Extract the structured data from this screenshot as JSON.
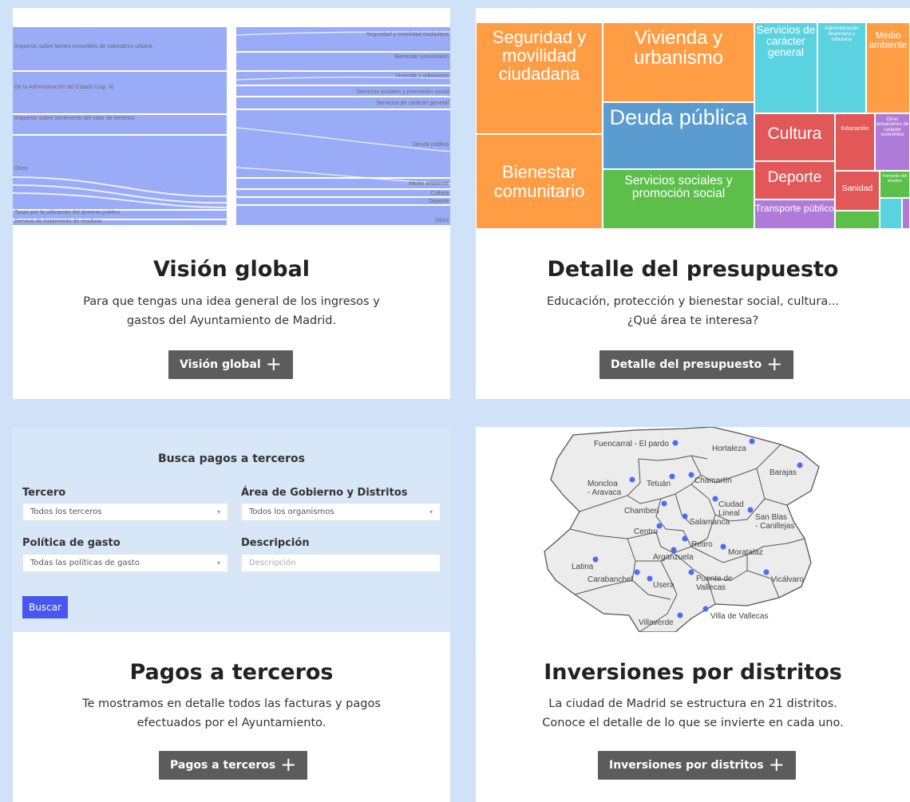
{
  "cards": {
    "global": {
      "title": "Visión global",
      "desc_line1": "Para que tengas una idea general de los ingresos y",
      "desc_line2": "gastos del Ayuntamiento de Madrid.",
      "button": "Visión global"
    },
    "detail": {
      "title": "Detalle del presupuesto",
      "desc_line1": "Educación, protección y bienestar social, cultura...",
      "desc_line2": "¿Qué área te interesa?",
      "button": "Detalle del presupuesto"
    },
    "payments": {
      "title": "Pagos a terceros",
      "desc_line1": "Te mostramos en detalle todos las facturas y pagos",
      "desc_line2": "efectuados por el Ayuntamiento.",
      "button": "Pagos a terceros"
    },
    "investments": {
      "title": "Inversiones por distritos",
      "desc_line1": "La ciudad de Madrid se estructura en 21 distritos.",
      "desc_line2": "Conoce el detalle de lo que se invierte en cada uno.",
      "button": "Inversiones por distritos"
    }
  },
  "sankey": {
    "left": [
      "Impuesto sobre bienes inmuebles de naturaleza urbana",
      "De la Administración del Estado (cap. 4)",
      "Impuesto sobre incremento del valor de terrenos",
      "Otros",
      "Tasas por la utilización del dominio público",
      "Servicio de tratamiento de residuos"
    ],
    "right": [
      "Seguridad y movilidad ciudadana",
      "Bienestar comunitario",
      "Vivienda y urbanismo",
      "Servicios sociales y promoción social",
      "Servicios de carácter general",
      "Deuda pública",
      "Medio ambiente",
      "Cultura",
      "Deporte",
      "Otros"
    ],
    "color": "#9aacf7"
  },
  "treemap": {
    "seguridad": "Seguridad y movilidad ciudadana",
    "vivienda": "Vivienda y urbanismo",
    "servicios": "Servicios de carácter general",
    "admin": "Administración financiera y tributaria",
    "medio": "Medio ambiente",
    "bienestar": "Bienestar comunitario",
    "deuda": "Deuda pública",
    "cultura": "Cultura",
    "educacion": "Educación",
    "otras": "Otras actuaciones de carácter económico",
    "sociales": "Servicios sociales y promoción social",
    "deporte": "Deporte",
    "sanidad": "Sanidad",
    "fomento": "Fomento del empleo",
    "transporte": "Transporte público",
    "colors": {
      "orange": "#ff9d45",
      "blue": "#5a9bd0",
      "cyan": "#5ad2e0",
      "red": "#e25858",
      "green": "#5bbf4a",
      "purple": "#b07ad8"
    }
  },
  "search": {
    "title": "Busca pagos a terceros",
    "tercero_label": "Tercero",
    "tercero_value": "Todos los terceros",
    "area_label": "Área de Gobierno y Distritos",
    "area_value": "Todos los organismos",
    "politica_label": "Política de gasto",
    "politica_value": "Todas las políticas de gasto",
    "descripcion_label": "Descripción",
    "descripcion_placeholder": "Descripción",
    "button": "Buscar"
  },
  "map": {
    "districts": [
      "Fuencarral - El pardo",
      "Hortaleza",
      "Barajas",
      "Moncloa - Aravaca",
      "Tetuán",
      "Chamartín",
      "Ciudad Lineal",
      "Chamberí",
      "Salamanca",
      "San Blas - Canillejas",
      "Centro",
      "Retiro",
      "Moratalaz",
      "Arganzuela",
      "Latina",
      "Carabanchel",
      "Usera",
      "Puente de Vallecas",
      "Vicálvaro",
      "Villaverde",
      "Villa de Vallecas"
    ],
    "dot_color": "#4a6cf7"
  }
}
